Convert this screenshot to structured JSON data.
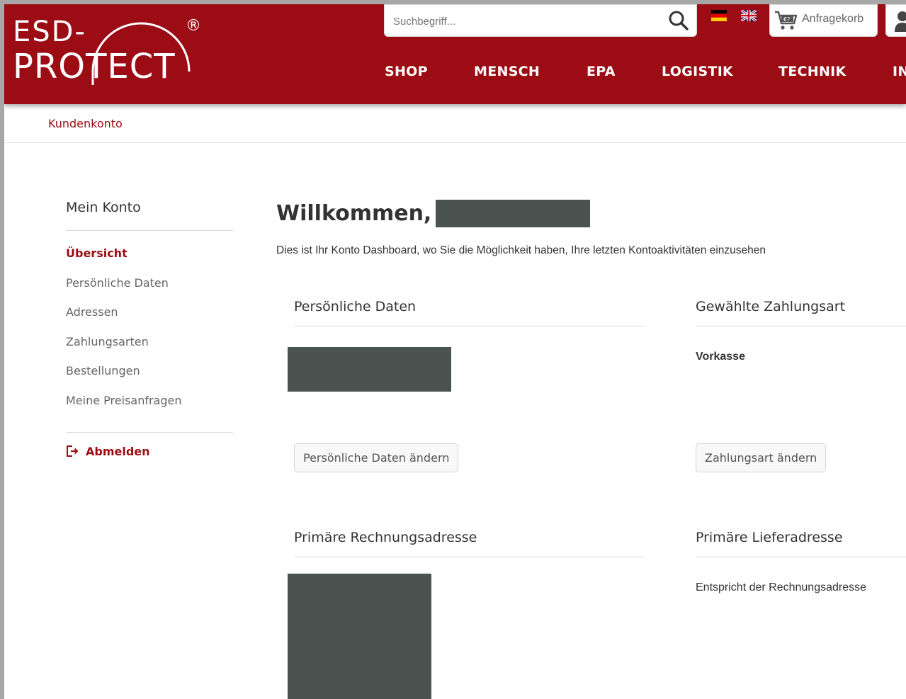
{
  "brand": {
    "logo_line1": "ESD-",
    "logo_line2": "PROTECT",
    "registered": "®",
    "color": "#9b0c14"
  },
  "search": {
    "placeholder": "Suchbegriff...",
    "icon": "magnifier-icon"
  },
  "languages": [
    "de",
    "en-gb"
  ],
  "cart": {
    "label": "Anfragekorb",
    "icon": "cart-euro-icon"
  },
  "nav": {
    "items": [
      {
        "label": "SHOP"
      },
      {
        "label": "MENSCH"
      },
      {
        "label": "EPA"
      },
      {
        "label": "LOGISTIK"
      },
      {
        "label": "TECHNIK"
      },
      {
        "label": "IN"
      }
    ]
  },
  "breadcrumb": "Kundenkonto",
  "sidebar": {
    "title": "Mein Konto",
    "items": [
      {
        "label": "Übersicht",
        "active": true
      },
      {
        "label": "Persönliche Daten"
      },
      {
        "label": "Adressen"
      },
      {
        "label": "Zahlungsarten"
      },
      {
        "label": "Bestellungen"
      },
      {
        "label": "Meine Preisanfragen"
      }
    ],
    "logout": "Abmelden"
  },
  "main": {
    "welcome": "Willkommen,",
    "intro": "Dies ist Ihr Konto Dashboard, wo Sie die Möglichkeit haben, Ihre letzten Kontoaktivitäten einzusehen",
    "personal": {
      "title": "Persönliche Daten",
      "button": "Persönliche Daten ändern"
    },
    "payment": {
      "title": "Gewählte Zahlungsart",
      "value": "Vorkasse",
      "button": "Zahlungsart ändern"
    },
    "billing": {
      "title": "Primäre Rechnungsadresse"
    },
    "shipping": {
      "title": "Primäre Lieferadresse",
      "value": "Entspricht der Rechnungsadresse"
    }
  }
}
